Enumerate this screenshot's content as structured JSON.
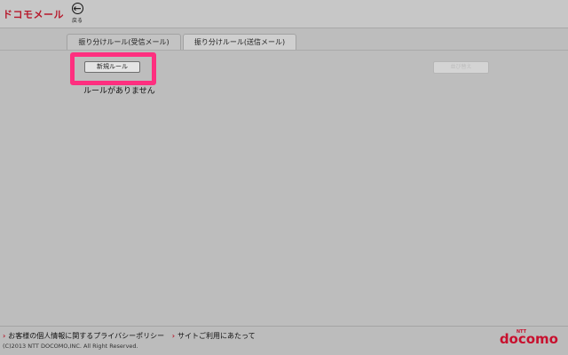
{
  "header": {
    "logo": "ドコモメール",
    "back_icon_glyph": "←",
    "back_label": "戻る"
  },
  "tabs": [
    {
      "label": "振り分けルール(受信メール)",
      "active": true
    },
    {
      "label": "振り分けルール(送信メール)",
      "active": false
    }
  ],
  "actions": {
    "new_rule_label": "新規ルール",
    "reorder_label": "並び替え"
  },
  "content": {
    "empty_message": "ルールがありません"
  },
  "footer": {
    "chevron_glyph": "›",
    "privacy_link": "お客様の個人情報に関するプライバシーポリシー",
    "site_link": "サイトご利用にあたって",
    "copyright": "(C)2013 NTT DOCOMO,INC. All Right Reserved.",
    "brand": "docomo",
    "brand_small": "NTT"
  },
  "colors": {
    "brand_red": "#c8102e",
    "highlight": "#ff2f7f",
    "background": "#bdbdbd"
  }
}
